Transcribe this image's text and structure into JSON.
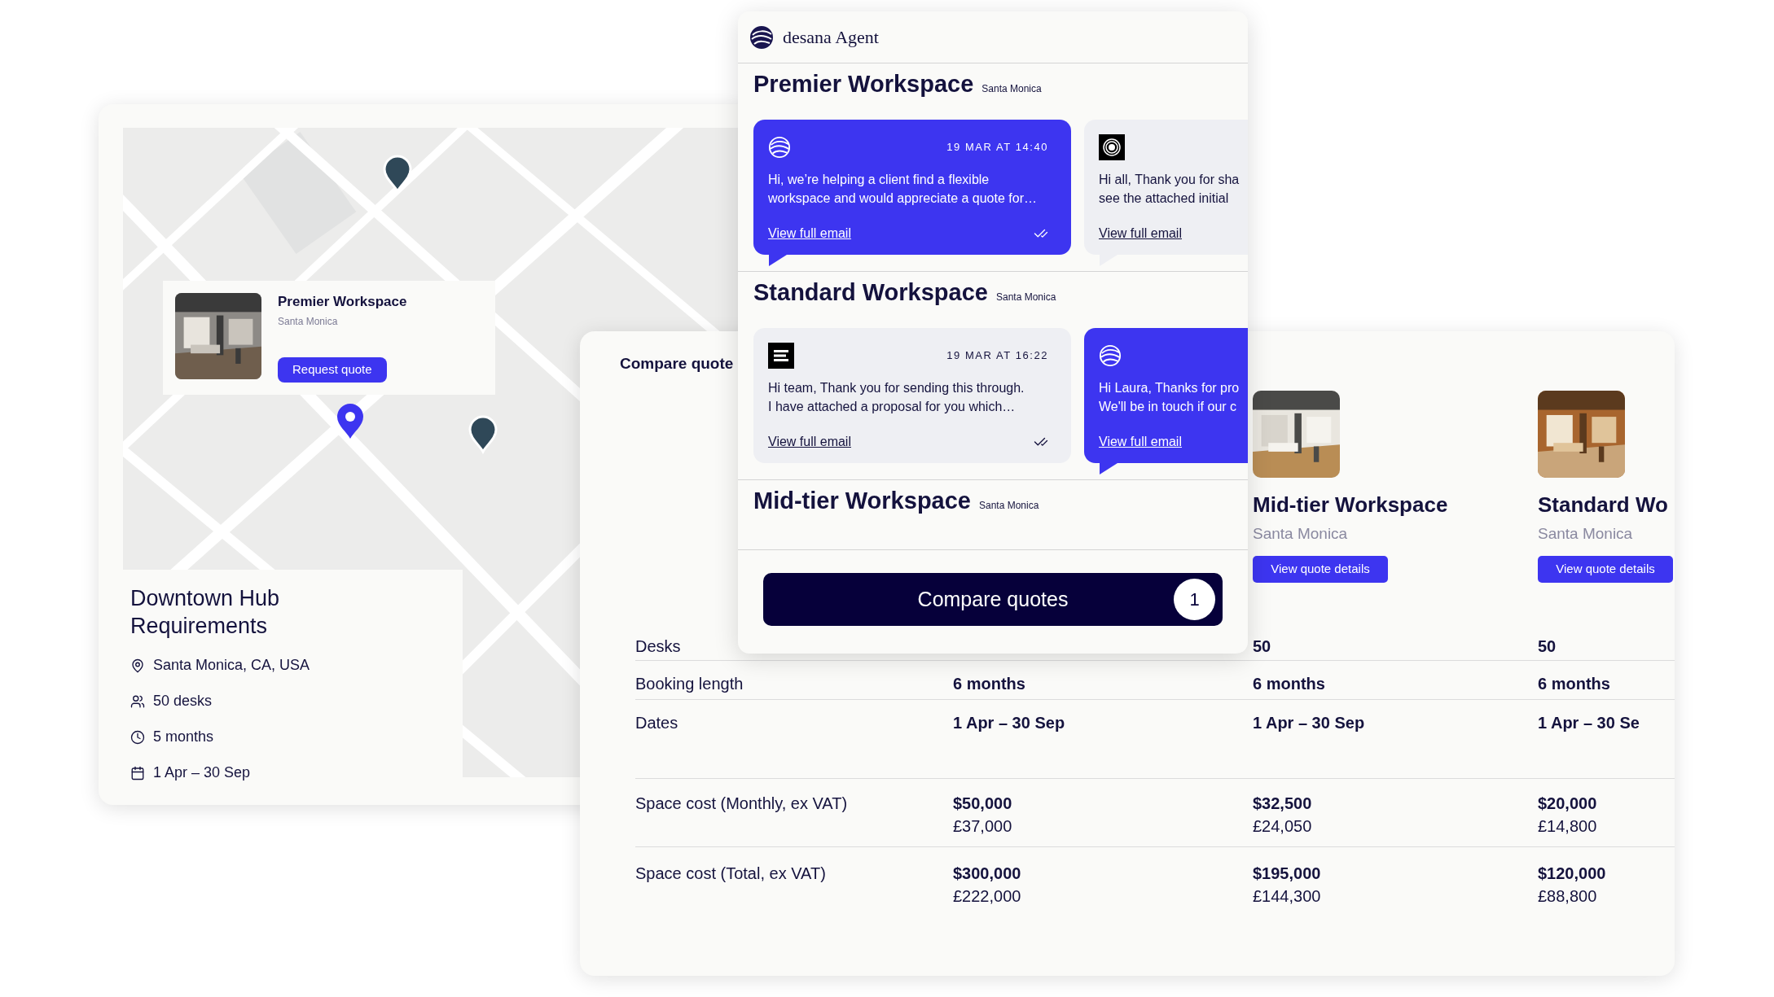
{
  "requirements_card": {
    "map_popup": {
      "title": "Premier Workspace",
      "location": "Santa Monica",
      "button": "Request quote"
    },
    "title": "Downtown Hub Requirements",
    "details": [
      {
        "kind": "location",
        "text": "Santa Monica, CA, USA"
      },
      {
        "kind": "desks",
        "text": "50 desks"
      },
      {
        "kind": "duration",
        "text": "5 months"
      },
      {
        "kind": "dates",
        "text": "1 Apr – 30 Sep"
      }
    ]
  },
  "compare_card": {
    "title": "Compare quote",
    "columns": [
      {
        "name": "Mid-tier Workspace",
        "location": "Santa Monica",
        "button": "View quote details"
      },
      {
        "name": "Standard Wo",
        "location": "Santa Monica",
        "button": "View quote details"
      }
    ],
    "rows": [
      {
        "label": "Desks",
        "values": [
          {
            "main": "50"
          },
          {
            "main": "50"
          }
        ]
      },
      {
        "label": "Booking length",
        "values": [
          {
            "main": "6 months"
          },
          {
            "main": "6 months"
          },
          {
            "main": "6 months"
          }
        ]
      },
      {
        "label": "Dates",
        "values": [
          {
            "main": "1 Apr – 30 Sep"
          },
          {
            "main": "1 Apr – 30 Sep"
          },
          {
            "main": "1 Apr – 30 Se"
          }
        ]
      },
      {
        "label": "Space cost (Monthly, ex VAT)",
        "values": [
          {
            "main": "$50,000",
            "sub": "£37,000"
          },
          {
            "main": "$32,500",
            "sub": "£24,050"
          },
          {
            "main": "$20,000",
            "sub": "£14,800"
          }
        ]
      },
      {
        "label": "Space cost (Total, ex VAT)",
        "values": [
          {
            "main": "$300,000",
            "sub": "£222,000"
          },
          {
            "main": "$195,000",
            "sub": "£144,300"
          },
          {
            "main": "$120,000",
            "sub": "£88,800"
          }
        ]
      }
    ]
  },
  "agent_panel": {
    "brand": "desana Agent",
    "workspaces": [
      {
        "name": "Premier Workspace",
        "location": "Santa Monica",
        "emails": [
          {
            "kind": "agent",
            "avatar": {
              "kind": "logo"
            },
            "time": "19 MAR AT 14:40",
            "lines": [
              "Hi, we’re helping a client find a flexible",
              "workspace and would appreciate a quote for…"
            ],
            "link": "View full email",
            "read": true,
            "tail": true
          },
          {
            "kind": "provider",
            "avatar": {
              "kind": "rings"
            },
            "lines": [
              "Hi all, Thank you for sha",
              "see the attached initial"
            ],
            "link": "View full email",
            "tail": true
          }
        ]
      },
      {
        "name": "Standard Workspace",
        "location": "Santa Monica",
        "emails": [
          {
            "kind": "provider",
            "avatar": {
              "kind": "bars"
            },
            "time": "19 MAR AT 16:22",
            "lines": [
              "Hi team, Thank you for sending this through.",
              "I have attached a proposal for you which…"
            ],
            "link": "View full email",
            "read": true,
            "tail": false
          },
          {
            "kind": "agent",
            "avatar": {
              "kind": "logo"
            },
            "lines": [
              "Hi Laura, Thanks for pro",
              "We'll be in touch if our c"
            ],
            "link": "View full email",
            "tail": true
          }
        ]
      },
      {
        "name": "Mid-tier Workspace",
        "location": "Santa Monica"
      }
    ],
    "compare_button": {
      "label": "Compare quotes",
      "count": "1"
    }
  }
}
